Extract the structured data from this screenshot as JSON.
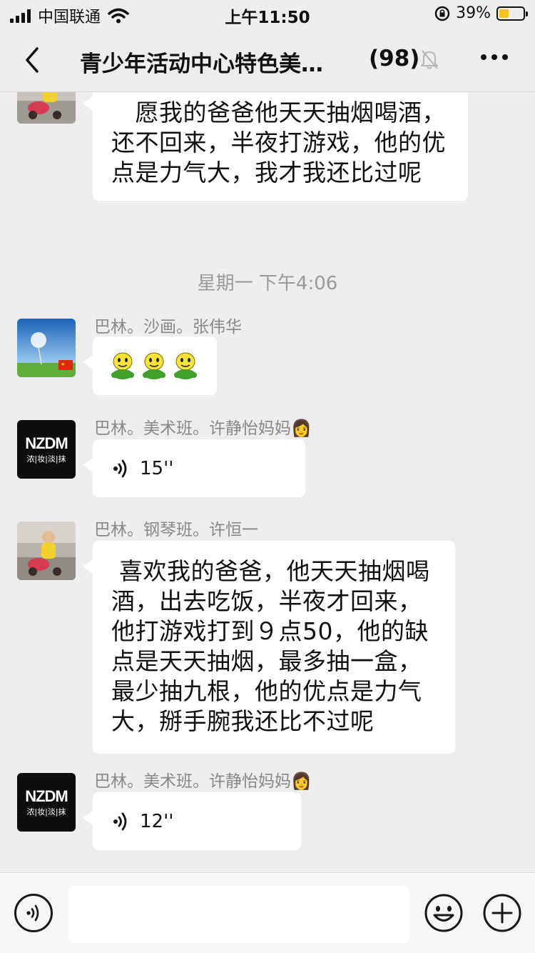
{
  "status_bar": {
    "carrier": "中国联通",
    "time": "上午11:50",
    "battery_percent": "39%"
  },
  "nav": {
    "title": "青少年活动中心特色美…",
    "member_count": "(98)",
    "muted": true
  },
  "messages": [
    {
      "type": "text",
      "sender": "",
      "avatar": "child-on-tricycle-photo",
      "text": "　愿我的爸爸他天天抽烟喝酒，还不回来，半夜打游戏，他的优点是力气大，我才我还比过呢"
    },
    {
      "type": "timestamp",
      "text": "星期一 下午4:06"
    },
    {
      "type": "emoji",
      "sender": "巴林。沙画。张伟华",
      "avatar": "dandelion-sky-photo",
      "emoji_names": [
        "green-smiley-emoji",
        "green-smiley-emoji",
        "green-smiley-emoji"
      ]
    },
    {
      "type": "voice",
      "sender": "巴林。美术班。许静怡妈妈👩",
      "avatar": "nzdm-logo",
      "avatar_text": "NZDM",
      "avatar_subtext": "浓|妆|淡|抹",
      "duration": "15''"
    },
    {
      "type": "text",
      "sender": "巴林。钢琴班。许恒一",
      "avatar": "child-on-tricycle-photo",
      "text": " 喜欢我的爸爸，他天天抽烟喝酒，出去吃饭，半夜才回来，他打游戏打到９点50，他的缺点是天天抽烟，最多抽一盒，最少抽九根，他的优点是力气大，掰手腕我还比不过呢"
    },
    {
      "type": "voice",
      "sender": "巴林。美术班。许静怡妈妈👩",
      "avatar": "nzdm-logo",
      "avatar_text": "NZDM",
      "avatar_subtext": "浓|妆|淡|抹",
      "duration": "12''"
    }
  ],
  "input_bar": {
    "placeholder": ""
  },
  "colors": {
    "background": "#ededed",
    "bubble": "#ffffff",
    "sender_text": "#888888",
    "battery_fill": "#f4c21c"
  }
}
